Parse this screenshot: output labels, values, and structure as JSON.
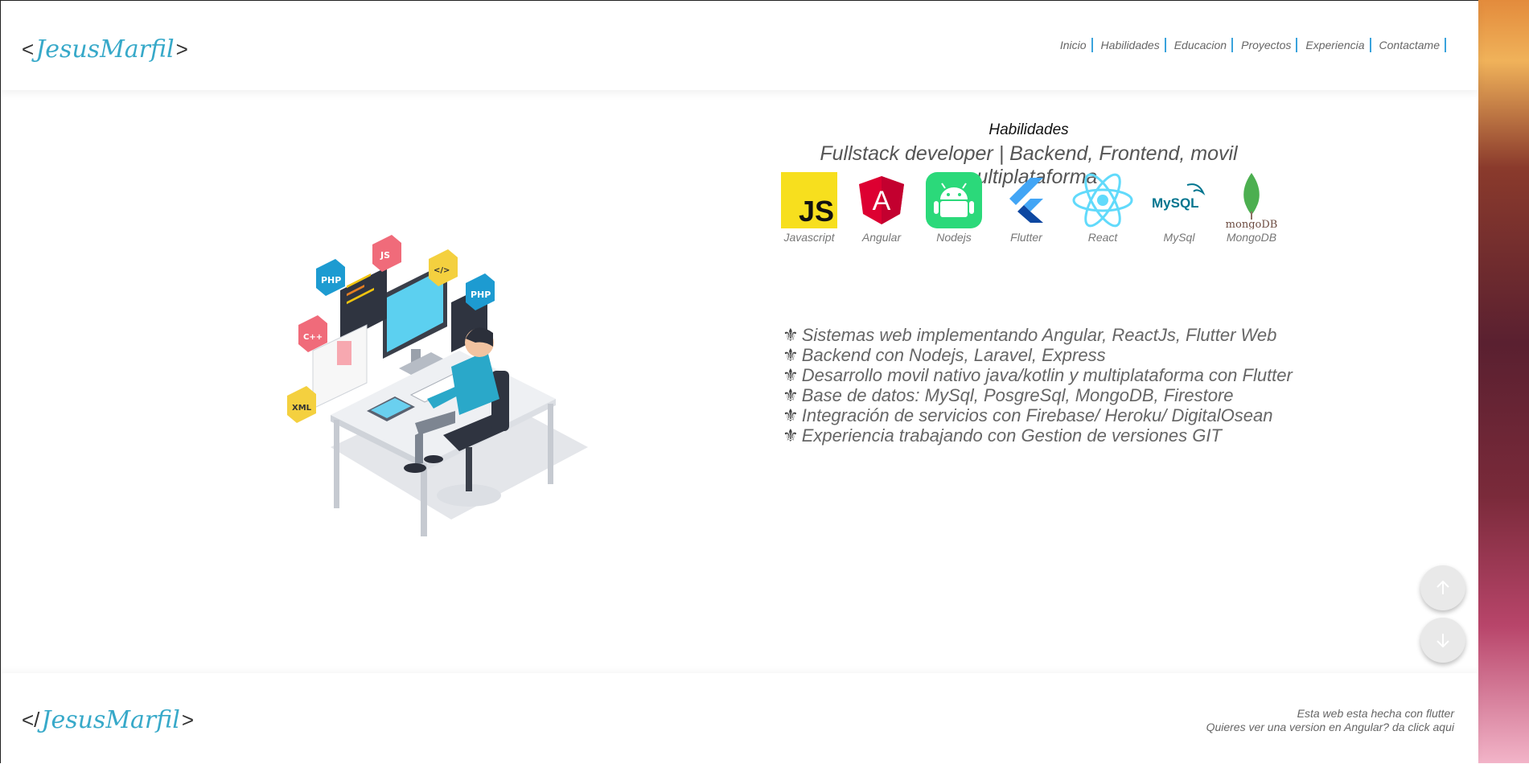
{
  "header": {
    "logo": {
      "open": "<",
      "name": "JesusMarfil",
      "close": ">"
    },
    "nav": [
      {
        "label": "Inicio"
      },
      {
        "label": "Habilidades"
      },
      {
        "label": "Educacion"
      },
      {
        "label": "Proyectos"
      },
      {
        "label": "Experiencia"
      },
      {
        "label": "Contactame"
      }
    ]
  },
  "hero": {
    "illustration_icon": "developer-at-desk-illustration",
    "tags": [
      "PHP",
      "JS",
      "</>",
      "PHP",
      "C++",
      "XML"
    ]
  },
  "skills": {
    "title": "Habilidades",
    "subtitle": "Fullstack developer | Backend, Frontend, movil multiplataforma",
    "techs": [
      {
        "name": "Javascript",
        "icon": "javascript-icon",
        "color": "#f7df1e",
        "badge": "JS"
      },
      {
        "name": "Angular",
        "icon": "angular-icon",
        "color": "#dd0031",
        "badge": "A"
      },
      {
        "name": "Nodejs",
        "icon": "android-icon",
        "color": "#2bd97a"
      },
      {
        "name": "Flutter",
        "icon": "flutter-icon",
        "color": "#42a5f5"
      },
      {
        "name": "React",
        "icon": "react-icon",
        "color": "#61dafb"
      },
      {
        "name": "MySql",
        "icon": "mysql-icon",
        "color": "#00758f",
        "badge": "MySQL"
      },
      {
        "name": "MongoDB",
        "icon": "mongodb-icon",
        "color": "#4caf50",
        "badge": "mongoDB"
      }
    ],
    "bullet_mark": "⚜",
    "bullets": [
      "Sistemas web implementando Angular, ReactJs, Flutter Web",
      "Backend con Nodejs, Laravel, Express",
      "Desarrollo movil nativo java/kotlin y multiplataforma con Flutter",
      "Base de datos: MySql, PosgreSql, MongoDB, Firestore",
      "Integración de servicios con Firebase/ Heroku/ DigitalOsean",
      "Experiencia trabajando con Gestion de versiones GIT"
    ]
  },
  "fabs": {
    "up_icon": "arrow-up-icon",
    "down_icon": "arrow-down-icon"
  },
  "footer": {
    "logo": {
      "open": "</",
      "name": "JesusMarfil",
      "close": ">"
    },
    "line1": "Esta web esta hecha con flutter",
    "line2": "Quieres ver una version en Angular? da click aqui"
  },
  "colors": {
    "accent": "#3aa3dc",
    "logo": "#37a9c9"
  }
}
